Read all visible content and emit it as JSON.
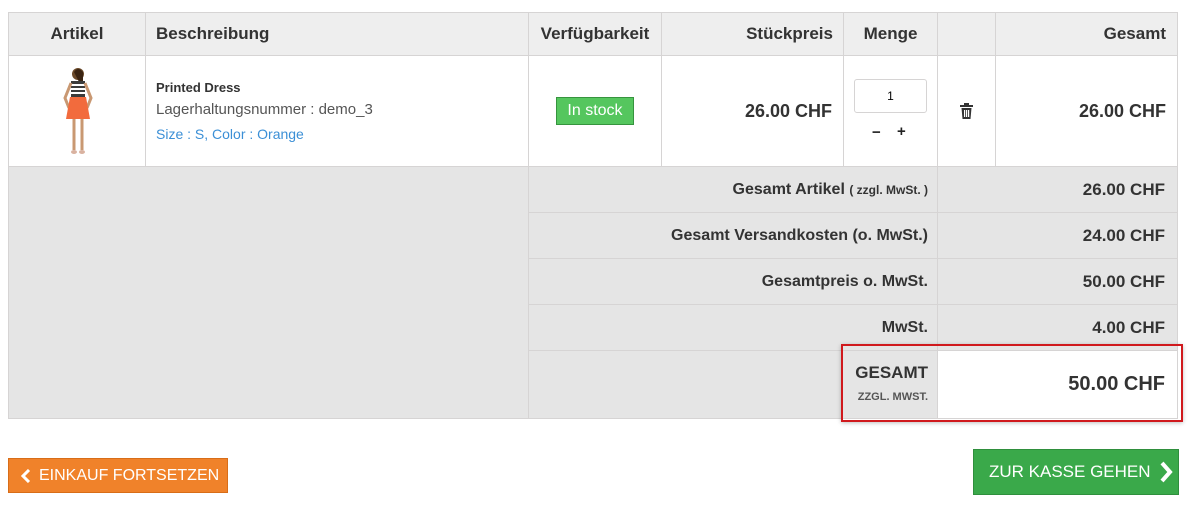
{
  "table": {
    "headers": {
      "artikel": "Artikel",
      "beschreibung": "Beschreibung",
      "verfuegbarkeit": "Verfügbarkeit",
      "stueckpreis": "Stückpreis",
      "menge": "Menge",
      "gesamt": "Gesamt"
    },
    "row": {
      "product_name": "Printed Dress",
      "sku_label": "Lagerhaltungsnummer : demo_3",
      "attributes": "Size : S, Color : Orange",
      "availability": "In stock",
      "unit_price": "26.00 CHF",
      "quantity": "1",
      "qty_minus": "−",
      "qty_plus": "+",
      "total": "26.00 CHF"
    }
  },
  "summary": {
    "total_products_label": "Gesamt Artikel",
    "total_products_note": "( zzgl. MwSt. )",
    "total_products_value": "26.00 CHF",
    "shipping_label": "Gesamt Versandkosten (o. MwSt.)",
    "shipping_value": "24.00 CHF",
    "total_without_tax_label": "Gesamtpreis o. MwSt.",
    "total_without_tax_value": "50.00 CHF",
    "tax_label": "MwSt.",
    "tax_value": "4.00 CHF",
    "grand_total_label": "GESAMT",
    "grand_total_note": "ZZGL. MWST.",
    "grand_total_value": "50.00 CHF"
  },
  "buttons": {
    "continue_shopping": "EINKAUF FORTSETZEN",
    "checkout": "ZUR KASSE GEHEN"
  },
  "colors": {
    "in_stock": "#55c65e",
    "continue_button": "#f0822a",
    "checkout_button": "#3aa94a",
    "attribute_link": "#3b8fd6",
    "highlight_border": "#d0191d"
  }
}
